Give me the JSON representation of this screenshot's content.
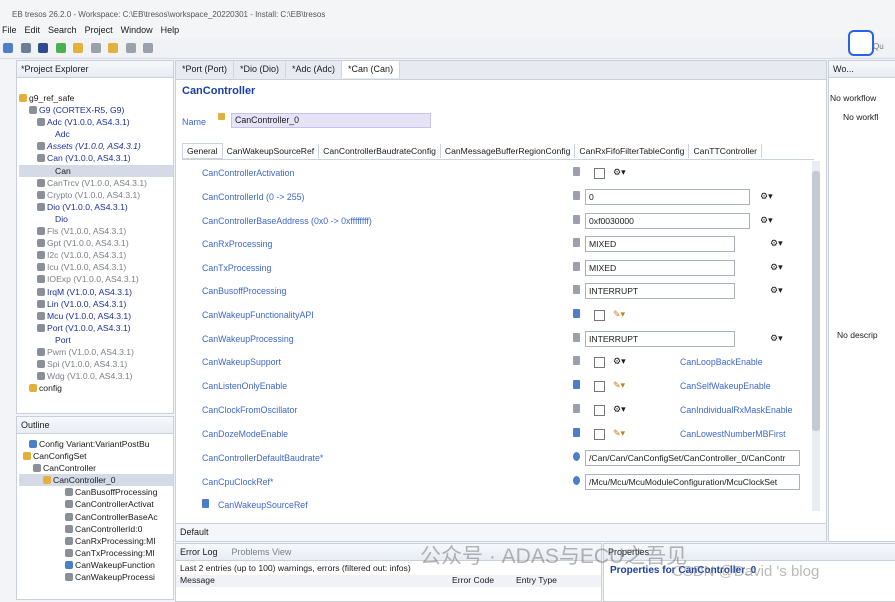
{
  "window": {
    "title": "EB tresos 26.2.0 - Workspace: C:\\EB\\tresos\\workspace_20220301 - Install: C:\\EB\\tresos"
  },
  "menu": [
    "File",
    "Edit",
    "Search",
    "Project",
    "Window",
    "Help"
  ],
  "project_explorer": {
    "title": "*Project Explorer",
    "items": [
      "g9_ref_safe",
      "G9 (CORTEX-R5, G9)",
      "Adc (V1.0.0, AS4.3.1)",
      "Adc",
      "Assets (V1.0.0, AS4.3.1)",
      "Can (V1.0.0, AS4.3.1)",
      "Can",
      "CanTrcv (V1.0.0, AS4.3.1)",
      "Crypto (V1.0.0, AS4.3.1)",
      "Dio (V1.0.0, AS4.3.1)",
      "Dio",
      "Fls (V1.0.0, AS4.3.1)",
      "Gpt (V1.0.0, AS4.3.1)",
      "I2c (V1.0.0, AS4.3.1)",
      "Icu (V1.0.0, AS4.3.1)",
      "IOExp (V1.0.0, AS4.3.1)",
      "IrqM (V1.0.0, AS4.3.1)",
      "Lin (V1.0.0, AS4.3.1)",
      "Mcu (V1.0.0, AS4.3.1)",
      "Port (V1.0.0, AS4.3.1)",
      "Port",
      "Pwm (V1.0.0, AS4.3.1)",
      "Spi (V1.0.0, AS4.3.1)",
      "Wdg (V1.0.0, AS4.3.1)",
      "config"
    ]
  },
  "outline": {
    "title": "Outline",
    "items": [
      "Config Variant:VariantPostBu",
      "CanConfigSet",
      "CanController",
      "CanController_0",
      "CanBusoffProcessing",
      "CanControllerActivat",
      "CanControllerBaseAc",
      "CanControllerId:0",
      "CanRxProcessing:MI",
      "CanTxProcessing:MI",
      "CanWakeupFunction",
      "CanWakeupProcessi"
    ]
  },
  "editor_tabs": [
    "*Port (Port)",
    "*Dio (Dio)",
    "*Adc (Adc)",
    "*Can (Can)"
  ],
  "editor": {
    "heading": "CanController",
    "name_label": "Name",
    "name_value": "CanController_0",
    "subtabs": [
      "General",
      "CanWakeupSourceRef",
      "CanControllerBaudrateConfig",
      "CanMessageBufferRegionConfig",
      "CanRxFifoFilterTableConfig",
      "CanTTController"
    ],
    "fields": [
      {
        "label": "CanControllerActivation",
        "value": ""
      },
      {
        "label": "CanControllerId (0 -> 255)",
        "value": "0"
      },
      {
        "label": "CanControllerBaseAddress (0x0 -> 0xffffffff)",
        "value": "0xf0030000"
      },
      {
        "label": "CanRxProcessing",
        "value": "MIXED"
      },
      {
        "label": "CanTxProcessing",
        "value": "MIXED"
      },
      {
        "label": "CanBusoffProcessing",
        "value": "INTERRUPT"
      },
      {
        "label": "CanWakeupFunctionalityAPI",
        "value": ""
      },
      {
        "label": "CanWakeupProcessing",
        "value": "INTERRUPT"
      },
      {
        "label": "CanWakeupSupport",
        "value": ""
      },
      {
        "label": "CanListenOnlyEnable",
        "value": ""
      },
      {
        "label": "CanClockFromOscillator",
        "value": ""
      },
      {
        "label": "CanDozeModeEnable",
        "value": ""
      },
      {
        "label": "CanControllerDefaultBaudrate*",
        "value": "/Can/Can/CanConfigSet/CanController_0/CanContr"
      },
      {
        "label": "CanCpuClockRef*",
        "value": "/Mcu/Mcu/McuModuleConfiguration/McuClockSet"
      },
      {
        "label": "CanWakeupSourceRef",
        "value": ""
      }
    ],
    "right_labels": [
      "CanLoopBackEnable",
      "CanSelfWakeupEnable",
      "CanIndividualRxMaskEnable",
      "CanLowestNumberMBFirst"
    ],
    "bottom_tab": "Default"
  },
  "workflow": {
    "title": "Wo...",
    "text": "No workflow",
    "body": "No workfl",
    "desc": "No descrip"
  },
  "bottom": {
    "errorlog": "Error Log",
    "problems": "Problems View",
    "summary": "Last 2 entries (up to 100) warnings, errors (filtered out: infos)",
    "cols": [
      "Message",
      "Error Code",
      "Entry Type"
    ],
    "properties_tab": "Properties",
    "properties_title": "Properties for CanController_0"
  },
  "watermark": "公众号 · ADAS与ECU之吾见",
  "watermark2": "CSDN @David 's blog",
  "search_hint": "Qu"
}
